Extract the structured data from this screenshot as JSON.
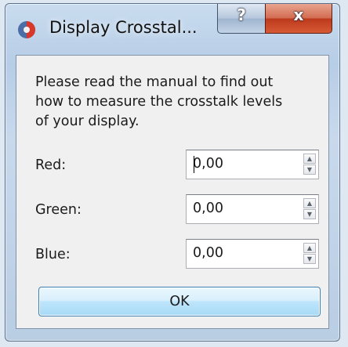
{
  "window": {
    "title": "Display Crosstal...",
    "help_glyph": "?",
    "close_glyph": "x",
    "app_icon": "qt-app-icon"
  },
  "dialog": {
    "message": "Please read the manual to find out\nhow to measure the crosstalk levels\nof your display.",
    "fields": [
      {
        "label": "Red:",
        "value": "0,00"
      },
      {
        "label": "Green:",
        "value": "0,00"
      },
      {
        "label": "Blue:",
        "value": "0,00"
      }
    ],
    "ok_label": "OK"
  },
  "colors": {
    "close_button": "#c8432a",
    "ok_border": "#3c7fb1"
  }
}
